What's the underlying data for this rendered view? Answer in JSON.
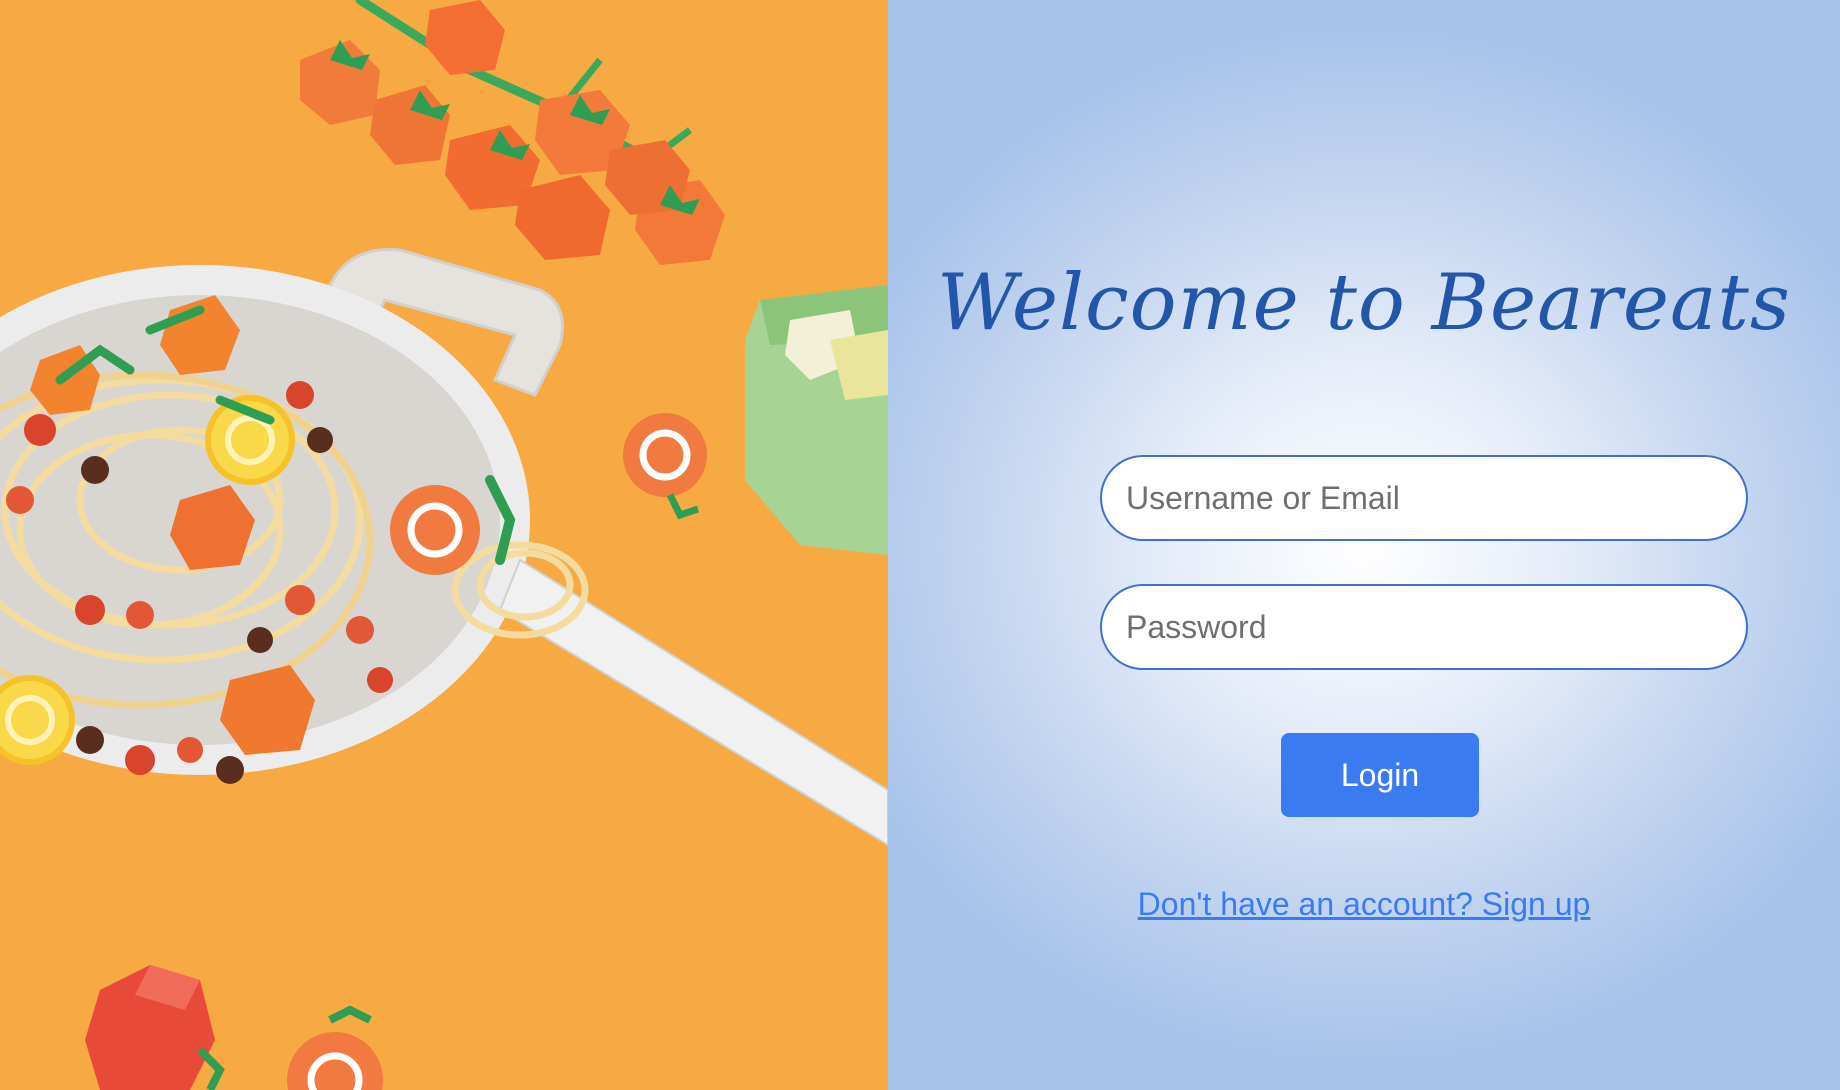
{
  "brand": {
    "welcome_title": "Welcome to Beareats"
  },
  "form": {
    "username_placeholder": "Username or Email",
    "username_value": "",
    "password_placeholder": "Password",
    "password_value": "",
    "login_label": "Login",
    "signup_link": "Don't have an account? Sign up"
  },
  "hero": {
    "image": "paper-craft-spaghetti-illustration"
  },
  "colors": {
    "hero_background": "#f7a944",
    "title": "#2355a8",
    "input_border": "#3f6fcf",
    "button": "#3a7bf2",
    "link": "#3a7bf2"
  }
}
